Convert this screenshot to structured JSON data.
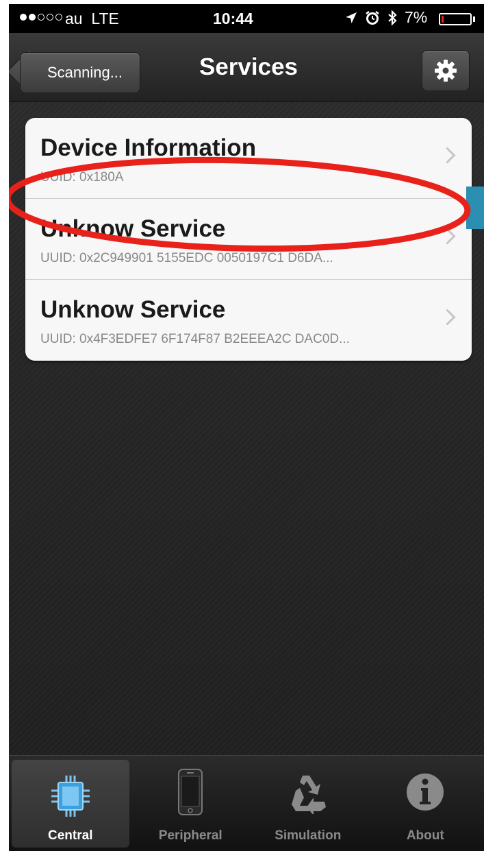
{
  "status_bar": {
    "carrier": "au",
    "network": "LTE",
    "time": "10:44",
    "battery_percent": "7%",
    "battery_level": 0.07,
    "signal_bars_filled": 2,
    "signal_bars_total": 5,
    "icons": [
      "location-arrow-icon",
      "alarm-icon",
      "bluetooth-icon",
      "battery-icon"
    ]
  },
  "nav": {
    "back_label": "Scanning...",
    "title": "Services",
    "settings_icon": "gear-icon"
  },
  "services": [
    {
      "title": "Device Information",
      "uuid": "UUID: 0x180A"
    },
    {
      "title": "Unknow Service",
      "uuid": "UUID: 0x2C949901 5155EDC 0050197C1 D6DA..."
    },
    {
      "title": "Unknow Service",
      "uuid": "UUID: 0x4F3EDFE7 6F174F87 B2EEEA2C DAC0D..."
    }
  ],
  "annotation": {
    "type": "ellipse",
    "target": "services.1",
    "color": "#e8211a"
  },
  "tabs": [
    {
      "label": "Central",
      "icon": "chip-icon",
      "selected": true
    },
    {
      "label": "Peripheral",
      "icon": "phone-icon",
      "selected": false
    },
    {
      "label": "Simulation",
      "icon": "recycle-icon",
      "selected": false
    },
    {
      "label": "About",
      "icon": "info-icon",
      "selected": false
    }
  ],
  "colors": {
    "battery_low": "#e2231a",
    "annotation_red": "#e8211a",
    "central_icon_blue": "#3aa0e0"
  }
}
